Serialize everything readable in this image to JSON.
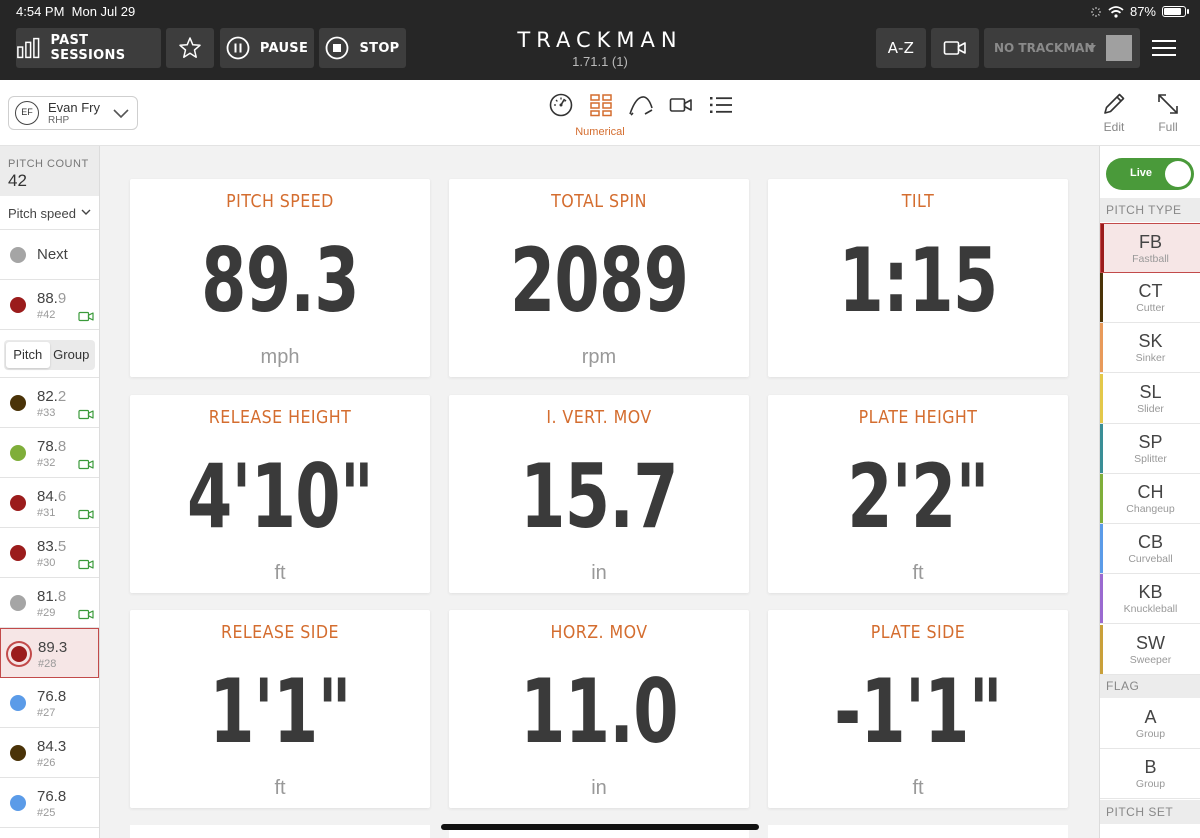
{
  "status": {
    "time": "4:54 PM",
    "date": "Mon Jul 29",
    "battery": "87%",
    "battery_level": 0.87
  },
  "topbar": {
    "past_sessions": "PAST SESSIONS",
    "pause": "PAUSE",
    "stop": "STOP",
    "brand": "TRACKMAN",
    "version": "1.71.1 (1)",
    "az": "A-Z",
    "device": "NO TRACKMAN"
  },
  "player": {
    "initials": "EF",
    "name": "Evan Fry",
    "hand": "RHP"
  },
  "views": {
    "active_label": "Numerical"
  },
  "tools": {
    "edit": "Edit",
    "full": "Full"
  },
  "left": {
    "pitch_count_label": "PITCH COUNT",
    "pitch_count": "42",
    "sort": "Pitch speed",
    "next": "Next",
    "segment": {
      "pitch": "Pitch",
      "group": "Group"
    },
    "rows_top": [
      {
        "speed_int": "88.",
        "speed_dec": "9",
        "num": "#42",
        "color": "#9b1c1c"
      }
    ],
    "rows": [
      {
        "speed_int": "82.",
        "speed_dec": "2",
        "num": "#33",
        "color": "#4a3308"
      },
      {
        "speed_int": "78.",
        "speed_dec": "8",
        "num": "#32",
        "color": "#7fae3a"
      },
      {
        "speed_int": "84.",
        "speed_dec": "6",
        "num": "#31",
        "color": "#9b1c1c"
      },
      {
        "speed_int": "83.",
        "speed_dec": "5",
        "num": "#30",
        "color": "#9b1c1c"
      },
      {
        "speed_int": "81.",
        "speed_dec": "8",
        "num": "#29",
        "color": "#a5a5a5"
      },
      {
        "speed_int": "89.3",
        "speed_dec": "",
        "num": "#28",
        "color": "#9b1c1c"
      },
      {
        "speed_int": "76.8",
        "speed_dec": "",
        "num": "#27",
        "color": "#5b9be8"
      },
      {
        "speed_int": "84.3",
        "speed_dec": "",
        "num": "#26",
        "color": "#4a3308"
      },
      {
        "speed_int": "76.8",
        "speed_dec": "",
        "num": "#25",
        "color": "#5b9be8"
      }
    ]
  },
  "metrics": [
    {
      "title": "PITCH SPEED",
      "value": "89.3",
      "unit": "mph"
    },
    {
      "title": "TOTAL SPIN",
      "value": "2089",
      "unit": "rpm"
    },
    {
      "title": "TILT",
      "value": "1:15",
      "unit": ""
    },
    {
      "title": "RELEASE HEIGHT",
      "value": "4'10\"",
      "unit": "ft"
    },
    {
      "title": "I. VERT. MOV",
      "value": "15.7",
      "unit": "in"
    },
    {
      "title": "PLATE HEIGHT",
      "value": "2'2\"",
      "unit": "ft"
    },
    {
      "title": "RELEASE SIDE",
      "value": "1'1\"",
      "unit": "ft"
    },
    {
      "title": "HORZ. MOV",
      "value": "11.0",
      "unit": "in"
    },
    {
      "title": "PLATE SIDE",
      "value": "-1'1\"",
      "unit": "ft"
    }
  ],
  "right": {
    "live": "Live",
    "pitch_type_label": "PITCH TYPE",
    "types": [
      {
        "ab": "FB",
        "full": "Fastball",
        "color": "#9b1c1c"
      },
      {
        "ab": "CT",
        "full": "Cutter",
        "color": "#4a3308"
      },
      {
        "ab": "SK",
        "full": "Sinker",
        "color": "#e89a5a"
      },
      {
        "ab": "SL",
        "full": "Slider",
        "color": "#e3c84a"
      },
      {
        "ab": "SP",
        "full": "Splitter",
        "color": "#3a8e96"
      },
      {
        "ab": "CH",
        "full": "Changeup",
        "color": "#7fae3a"
      },
      {
        "ab": "CB",
        "full": "Curveball",
        "color": "#5b9be8"
      },
      {
        "ab": "KB",
        "full": "Knuckleball",
        "color": "#9a6ad0"
      },
      {
        "ab": "SW",
        "full": "Sweeper",
        "color": "#c9a03a"
      }
    ],
    "flag_label": "FLAG",
    "flags": [
      {
        "ab": "A",
        "full": "Group"
      },
      {
        "ab": "B",
        "full": "Group"
      }
    ],
    "pitch_set_label": "PITCH SET"
  }
}
